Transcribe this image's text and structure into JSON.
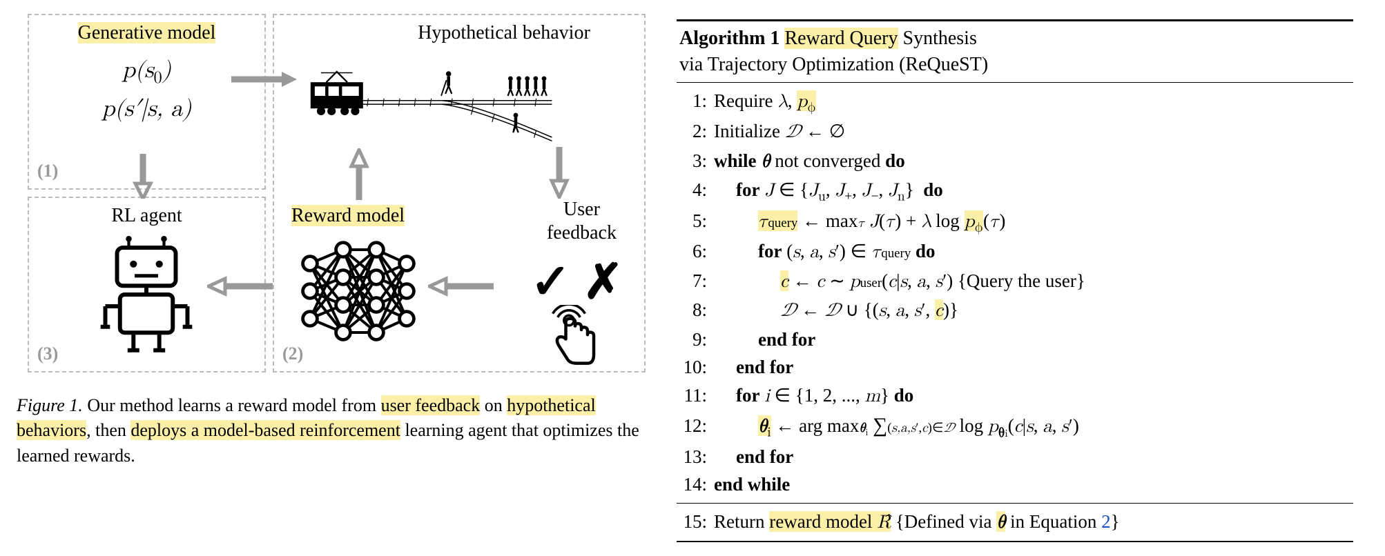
{
  "figure": {
    "box1": {
      "label": "(1)",
      "title": "Generative model",
      "eq1": "p(s0)",
      "eq2": "p(s′|s, a)"
    },
    "box2": {
      "label": "(2)",
      "title": "Reward model"
    },
    "box3": {
      "label": "(3)",
      "title": "RL agent"
    },
    "hyp_title": "Hypothetical behavior",
    "feedback_label_a": "User",
    "feedback_label_b": "feedback",
    "caption": {
      "label": "Figure 1.",
      "p1a": " Our method learns a reward model from ",
      "p1h1": "user feedback",
      "p1b": " on ",
      "p2h1": "hypothetical behaviors",
      "p2a": ", then ",
      "p2h2": "deploys a model-based reinforcement",
      "p2b": " learning agent that optimizes the learned rewards."
    }
  },
  "algorithm": {
    "title_a": "Algorithm 1",
    "title_h": "Reward Query",
    "title_b": " Synthesis",
    "subtitle": "via Trajectory Optimization (ReQueST)",
    "lines": {
      "l1a": "Require λ, ",
      "l1h": "pϕ",
      "l2": "Initialize 𝒟 ← ∅",
      "l3a": "while ",
      "l3b": "θ",
      "l3c": " not converged ",
      "l3d": "do",
      "l4a": "for ",
      "l4b": "J ∈ {Ju, J+, J−, Jn}",
      "l4c": "do",
      "l5h": "τquery",
      "l5a": " ← maxτ J(τ) + λ log ",
      "l5h2": "pϕ",
      "l5b": "(τ)",
      "l6a": "for ",
      "l6b": "(s, a, s′) ∈ τquery ",
      "l6c": "do",
      "l7h": "c",
      "l7a": " ← c ∼ puser(c|s, a, s′) {Query the user}",
      "l8a": "𝒟 ← 𝒟 ∪ {(s, a, s′, ",
      "l8h": "c",
      "l8b": ")}",
      "l9": "end for",
      "l10": "end for",
      "l11a": "for ",
      "l11b": "i ∈ {1, 2, ..., m} ",
      "l11c": "do",
      "l12h": "θi",
      "l12a": " ← arg maxθi Σ(s,a,s′,c)∈𝒟 log pθi(c|s, a, s′)",
      "l13": "end for",
      "l14": "end while",
      "l15a": "Return ",
      "l15h": "reward model R̂",
      "l15b": " {Defined via ",
      "l15h2": "θ",
      "l15c": " in Equation ",
      "l15link": "2",
      "l15d": "}"
    }
  }
}
